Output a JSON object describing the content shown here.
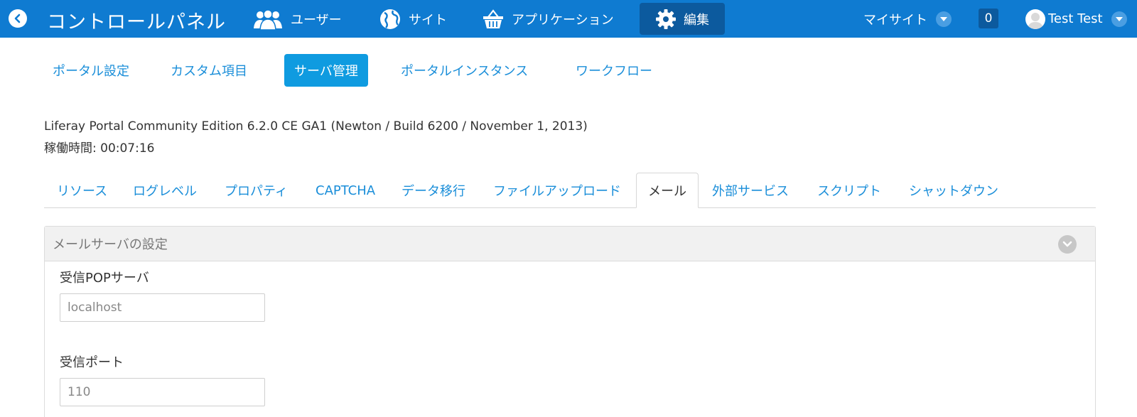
{
  "dockbar": {
    "title": "コントロールパネル",
    "nav": [
      {
        "label": "ユーザー",
        "icon": "users-icon"
      },
      {
        "label": "サイト",
        "icon": "globe-icon"
      },
      {
        "label": "アプリケーション",
        "icon": "basket-icon"
      },
      {
        "label": "編集",
        "icon": "gear-icon",
        "active": true
      }
    ],
    "my_sites": "マイサイト",
    "notification_count": "0",
    "user_name": "Test Test"
  },
  "admin_tabs": [
    {
      "label": "ポータル設定"
    },
    {
      "label": "カスタム項目"
    },
    {
      "label": "サーバ管理",
      "active": true
    },
    {
      "label": "ポータルインスタンス"
    },
    {
      "label": "ワークフロー"
    }
  ],
  "info": {
    "version": "Liferay Portal Community Edition 6.2.0 CE GA1 (Newton / Build 6200 / November 1, 2013)",
    "uptime": "稼働時間: 00:07:16"
  },
  "server_tabs": [
    {
      "label": "リソース"
    },
    {
      "label": "ログレベル"
    },
    {
      "label": "プロパティ"
    },
    {
      "label": "CAPTCHA"
    },
    {
      "label": "データ移行"
    },
    {
      "label": "ファイルアップロード"
    },
    {
      "label": "メール",
      "active": true
    },
    {
      "label": "外部サービス"
    },
    {
      "label": "スクリプト"
    },
    {
      "label": "シャットダウン"
    }
  ],
  "panel": {
    "title": "メールサーバの設定",
    "fields": [
      {
        "label": "受信POPサーバ",
        "value": "localhost"
      },
      {
        "label": "受信ポート",
        "value": "110"
      }
    ]
  },
  "colors": {
    "dockbar": "#0f7bd1",
    "active_nav": "#0c5a9e",
    "link": "#1a8ed9",
    "active_pill": "#0f9be0"
  }
}
